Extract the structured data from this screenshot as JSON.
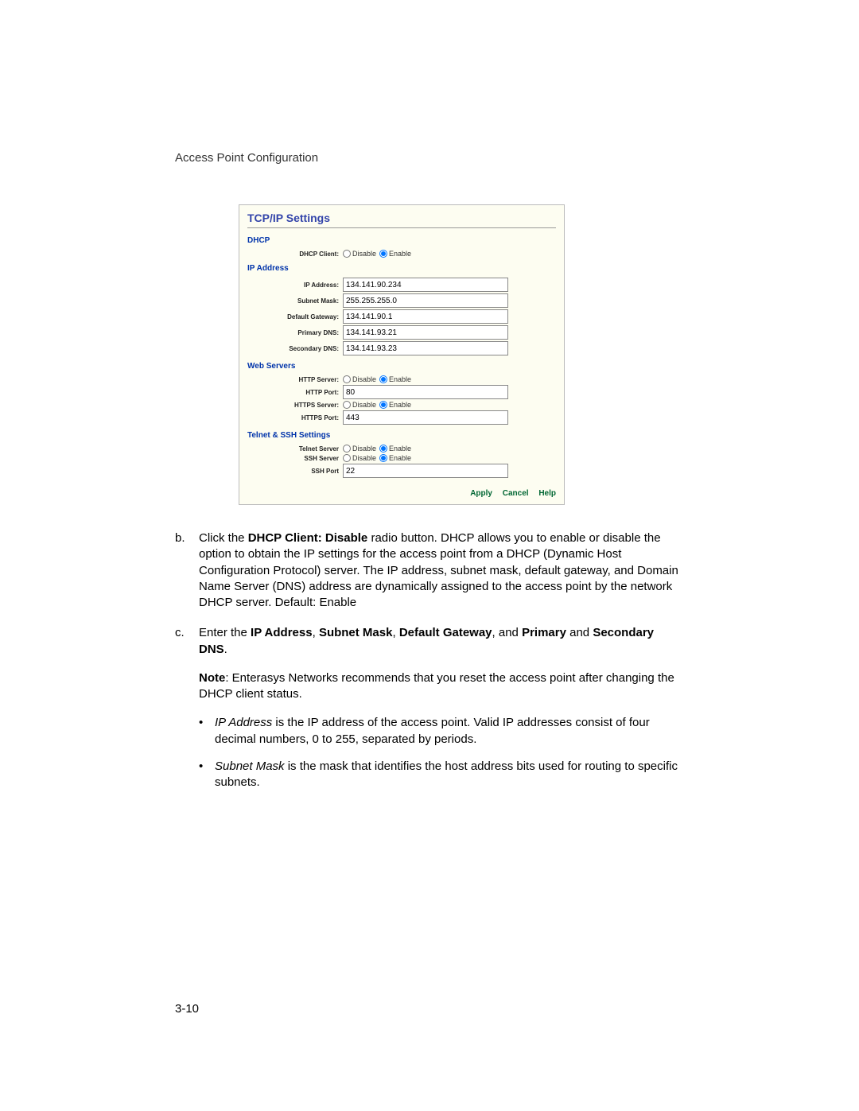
{
  "header": "Access Point Configuration",
  "page_number": "3-10",
  "panel": {
    "title": "TCP/IP Settings",
    "dhcp": {
      "section": "DHCP",
      "client_label": "DHCP Client:",
      "disable": "Disable",
      "enable": "Enable"
    },
    "ip": {
      "section": "IP Address",
      "addr_label": "IP Address:",
      "addr_value": "134.141.90.234",
      "mask_label": "Subnet Mask:",
      "mask_value": "255.255.255.0",
      "gw_label": "Default Gateway:",
      "gw_value": "134.141.90.1",
      "pdns_label": "Primary DNS:",
      "pdns_value": "134.141.93.21",
      "sdns_label": "Secondary DNS:",
      "sdns_value": "134.141.93.23"
    },
    "web": {
      "section": "Web Servers",
      "http_srv_label": "HTTP Server:",
      "http_port_label": "HTTP Port:",
      "http_port_value": "80",
      "https_srv_label": "HTTPS Server:",
      "https_port_label": "HTTPS Port:",
      "https_port_value": "443",
      "disable": "Disable",
      "enable": "Enable"
    },
    "telnet": {
      "section": "Telnet & SSH Settings",
      "telnet_label": "Telnet Server",
      "ssh_label": "SSH Server",
      "ssh_port_label": "SSH Port",
      "ssh_port_value": "22",
      "disable": "Disable",
      "enable": "Enable"
    },
    "actions": {
      "apply": "Apply",
      "cancel": "Cancel",
      "help": "Help"
    }
  },
  "steps": {
    "b": {
      "marker": "b.",
      "pre": "Click the ",
      "bold": "DHCP Client: Disable",
      "post": " radio button. DHCP allows you to enable or disable the option to obtain the IP settings for the access point from a DHCP (Dynamic Host Configuration Protocol) server. The IP address, subnet mask, default gateway, and Domain Name Server (DNS) address are dynamically assigned to the access point by the network DHCP server. Default: Enable"
    },
    "c": {
      "marker": "c.",
      "pre": "Enter the ",
      "b1": "IP Address",
      "s1": ", ",
      "b2": "Subnet Mask",
      "s2": ", ",
      "b3": "Default Gateway",
      "s3": ", and ",
      "b4": "Primary",
      "s4": " and ",
      "b5": "Secondary DNS",
      "post": ".",
      "note_pre": "Note",
      "note_post": ": Enterasys Networks recommends that you reset the access point after changing the DHCP client status.",
      "bullet1_it": "IP Address",
      "bullet1_rest": " is the IP address of the access point. Valid IP addresses consist of four decimal numbers, 0 to 255, separated by periods.",
      "bullet2_it": "Subnet Mask",
      "bullet2_rest": " is the mask that identifies the host address bits used for routing to specific subnets."
    }
  }
}
